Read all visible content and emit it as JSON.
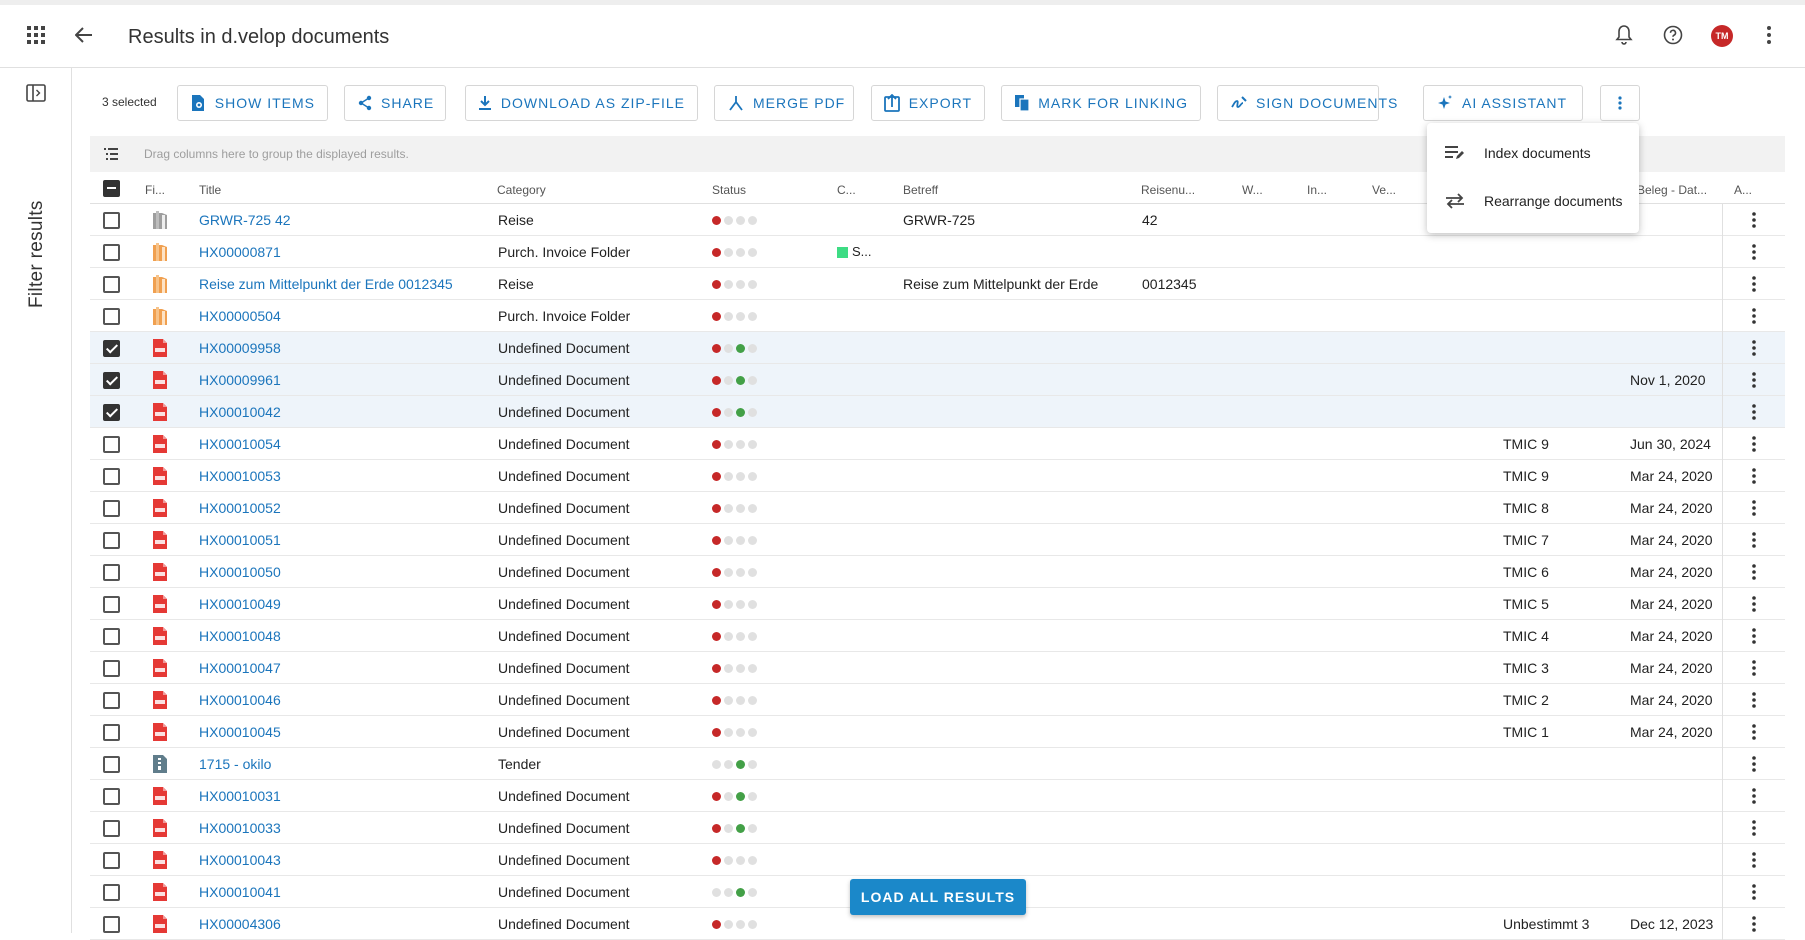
{
  "header": {
    "title": "Results in d.velop documents",
    "avatar_initials": "TM"
  },
  "sidebar": {
    "filter_label": "Filter results"
  },
  "toolbar": {
    "selected_count": "3 selected",
    "buttons": [
      {
        "label": "SHOW ITEMS",
        "icon": "show-items-icon"
      },
      {
        "label": "SHARE",
        "icon": "share-icon"
      },
      {
        "label": "DOWNLOAD AS ZIP-FILE",
        "icon": "download-icon"
      },
      {
        "label": "MERGE PDF",
        "icon": "merge-pdf-icon"
      },
      {
        "label": "EXPORT",
        "icon": "export-icon"
      },
      {
        "label": "MARK FOR LINKING",
        "icon": "link-icon"
      },
      {
        "label": "SIGN DOCUMENTS",
        "icon": "sign-icon"
      },
      {
        "label": "AI ASSISTANT",
        "icon": "sparkle-icon"
      }
    ]
  },
  "group_bar": {
    "hint": "Drag columns here to group the displayed results."
  },
  "table": {
    "columns": [
      "Fi...",
      "Title",
      "Category",
      "Status",
      "C...",
      "Betreff",
      "Reisenu...",
      "W...",
      "In...",
      "Ve...",
      "Beleg - Dat...",
      "A..."
    ],
    "rows": [
      {
        "checked": false,
        "icon": "folder-gray",
        "title": "GRWR-725 42",
        "category": "Reise",
        "status": [
          "red",
          "gray",
          "gray",
          "gray"
        ],
        "c": "",
        "betreff": "GRWR-725",
        "reisenummer": "42",
        "ve": "",
        "beleg": ""
      },
      {
        "checked": false,
        "icon": "folder-orange",
        "title": "HX00000871",
        "category": "Purch. Invoice Folder",
        "status": [
          "red",
          "gray",
          "gray",
          "gray"
        ],
        "c": "S...",
        "betreff": "",
        "reisenummer": "",
        "ve": "",
        "beleg": ""
      },
      {
        "checked": false,
        "icon": "folder-orange",
        "title": "Reise zum Mittelpunkt der Erde 0012345",
        "category": "Reise",
        "status": [
          "red",
          "gray",
          "gray",
          "gray"
        ],
        "c": "",
        "betreff": "Reise zum Mittelpunkt der Erde",
        "reisenummer": "0012345",
        "ve": "",
        "beleg": ""
      },
      {
        "checked": false,
        "icon": "folder-orange",
        "title": "HX00000504",
        "category": "Purch. Invoice Folder",
        "status": [
          "red",
          "gray",
          "gray",
          "gray"
        ],
        "c": "",
        "betreff": "",
        "reisenummer": "",
        "ve": "",
        "beleg": ""
      },
      {
        "checked": true,
        "icon": "pdf",
        "title": "HX00009958",
        "category": "Undefined Document",
        "status": [
          "red",
          "gray",
          "green",
          "gray"
        ],
        "c": "",
        "betreff": "",
        "reisenummer": "",
        "ve": "",
        "beleg": ""
      },
      {
        "checked": true,
        "icon": "pdf",
        "title": "HX00009961",
        "category": "Undefined Document",
        "status": [
          "red",
          "gray",
          "green",
          "gray"
        ],
        "c": "",
        "betreff": "",
        "reisenummer": "",
        "ve": "",
        "beleg": "Nov 1, 2020"
      },
      {
        "checked": true,
        "icon": "pdf",
        "title": "HX00010042",
        "category": "Undefined Document",
        "status": [
          "red",
          "gray",
          "green",
          "gray"
        ],
        "c": "",
        "betreff": "",
        "reisenummer": "",
        "ve": "",
        "beleg": ""
      },
      {
        "checked": false,
        "icon": "pdf",
        "title": "HX00010054",
        "category": "Undefined Document",
        "status": [
          "red",
          "gray",
          "gray",
          "gray"
        ],
        "c": "",
        "betreff": "",
        "reisenummer": "",
        "ve": "TMIC 9",
        "beleg": "Jun 30, 2024"
      },
      {
        "checked": false,
        "icon": "pdf",
        "title": "HX00010053",
        "category": "Undefined Document",
        "status": [
          "red",
          "gray",
          "gray",
          "gray"
        ],
        "c": "",
        "betreff": "",
        "reisenummer": "",
        "ve": "TMIC 9",
        "beleg": "Mar 24, 2020"
      },
      {
        "checked": false,
        "icon": "pdf",
        "title": "HX00010052",
        "category": "Undefined Document",
        "status": [
          "red",
          "gray",
          "gray",
          "gray"
        ],
        "c": "",
        "betreff": "",
        "reisenummer": "",
        "ve": "TMIC 8",
        "beleg": "Mar 24, 2020"
      },
      {
        "checked": false,
        "icon": "pdf",
        "title": "HX00010051",
        "category": "Undefined Document",
        "status": [
          "red",
          "gray",
          "gray",
          "gray"
        ],
        "c": "",
        "betreff": "",
        "reisenummer": "",
        "ve": "TMIC 7",
        "beleg": "Mar 24, 2020"
      },
      {
        "checked": false,
        "icon": "pdf",
        "title": "HX00010050",
        "category": "Undefined Document",
        "status": [
          "red",
          "gray",
          "gray",
          "gray"
        ],
        "c": "",
        "betreff": "",
        "reisenummer": "",
        "ve": "TMIC 6",
        "beleg": "Mar 24, 2020"
      },
      {
        "checked": false,
        "icon": "pdf",
        "title": "HX00010049",
        "category": "Undefined Document",
        "status": [
          "red",
          "gray",
          "gray",
          "gray"
        ],
        "c": "",
        "betreff": "",
        "reisenummer": "",
        "ve": "TMIC 5",
        "beleg": "Mar 24, 2020"
      },
      {
        "checked": false,
        "icon": "pdf",
        "title": "HX00010048",
        "category": "Undefined Document",
        "status": [
          "red",
          "gray",
          "gray",
          "gray"
        ],
        "c": "",
        "betreff": "",
        "reisenummer": "",
        "ve": "TMIC 4",
        "beleg": "Mar 24, 2020"
      },
      {
        "checked": false,
        "icon": "pdf",
        "title": "HX00010047",
        "category": "Undefined Document",
        "status": [
          "red",
          "gray",
          "gray",
          "gray"
        ],
        "c": "",
        "betreff": "",
        "reisenummer": "",
        "ve": "TMIC 3",
        "beleg": "Mar 24, 2020"
      },
      {
        "checked": false,
        "icon": "pdf",
        "title": "HX00010046",
        "category": "Undefined Document",
        "status": [
          "red",
          "gray",
          "gray",
          "gray"
        ],
        "c": "",
        "betreff": "",
        "reisenummer": "",
        "ve": "TMIC 2",
        "beleg": "Mar 24, 2020"
      },
      {
        "checked": false,
        "icon": "pdf",
        "title": "HX00010045",
        "category": "Undefined Document",
        "status": [
          "red",
          "gray",
          "gray",
          "gray"
        ],
        "c": "",
        "betreff": "",
        "reisenummer": "",
        "ve": "TMIC 1",
        "beleg": "Mar 24, 2020"
      },
      {
        "checked": false,
        "icon": "tender",
        "title": "1715 - okilo",
        "category": "Tender",
        "status": [
          "gray",
          "gray",
          "green",
          "gray"
        ],
        "c": "",
        "betreff": "",
        "reisenummer": "",
        "ve": "",
        "beleg": ""
      },
      {
        "checked": false,
        "icon": "pdf",
        "title": "HX00010031",
        "category": "Undefined Document",
        "status": [
          "red",
          "gray",
          "green",
          "gray"
        ],
        "c": "",
        "betreff": "",
        "reisenummer": "",
        "ve": "",
        "beleg": ""
      },
      {
        "checked": false,
        "icon": "pdf",
        "title": "HX00010033",
        "category": "Undefined Document",
        "status": [
          "red",
          "gray",
          "green",
          "gray"
        ],
        "c": "",
        "betreff": "",
        "reisenummer": "",
        "ve": "",
        "beleg": ""
      },
      {
        "checked": false,
        "icon": "pdf",
        "title": "HX00010043",
        "category": "Undefined Document",
        "status": [
          "red",
          "gray",
          "gray",
          "gray"
        ],
        "c": "",
        "betreff": "",
        "reisenummer": "",
        "ve": "",
        "beleg": ""
      },
      {
        "checked": false,
        "icon": "pdf",
        "title": "HX00010041",
        "category": "Undefined Document",
        "status": [
          "gray",
          "gray",
          "green",
          "gray"
        ],
        "c": "",
        "betreff": "",
        "reisenummer": "",
        "ve": "",
        "beleg": ""
      },
      {
        "checked": false,
        "icon": "pdf",
        "title": "HX00004306",
        "category": "Undefined Document",
        "status": [
          "red",
          "gray",
          "gray",
          "gray"
        ],
        "c": "",
        "betreff": "",
        "reisenummer": "",
        "ve": "Unbestimmt 3",
        "beleg": "Dec 12, 2023"
      }
    ]
  },
  "menu": {
    "items": [
      {
        "label": "Index documents",
        "icon": "index-documents-icon"
      },
      {
        "label": "Rearrange documents",
        "icon": "rearrange-icon"
      }
    ]
  },
  "load_button": {
    "label": "LOAD ALL RESULTS"
  },
  "colors": {
    "accent": "#1b75bc",
    "load_button": "#1b88c9",
    "avatar": "#c62828",
    "status_red": "#c62828",
    "status_green": "#43a047",
    "selected_row": "#eef4fa"
  }
}
